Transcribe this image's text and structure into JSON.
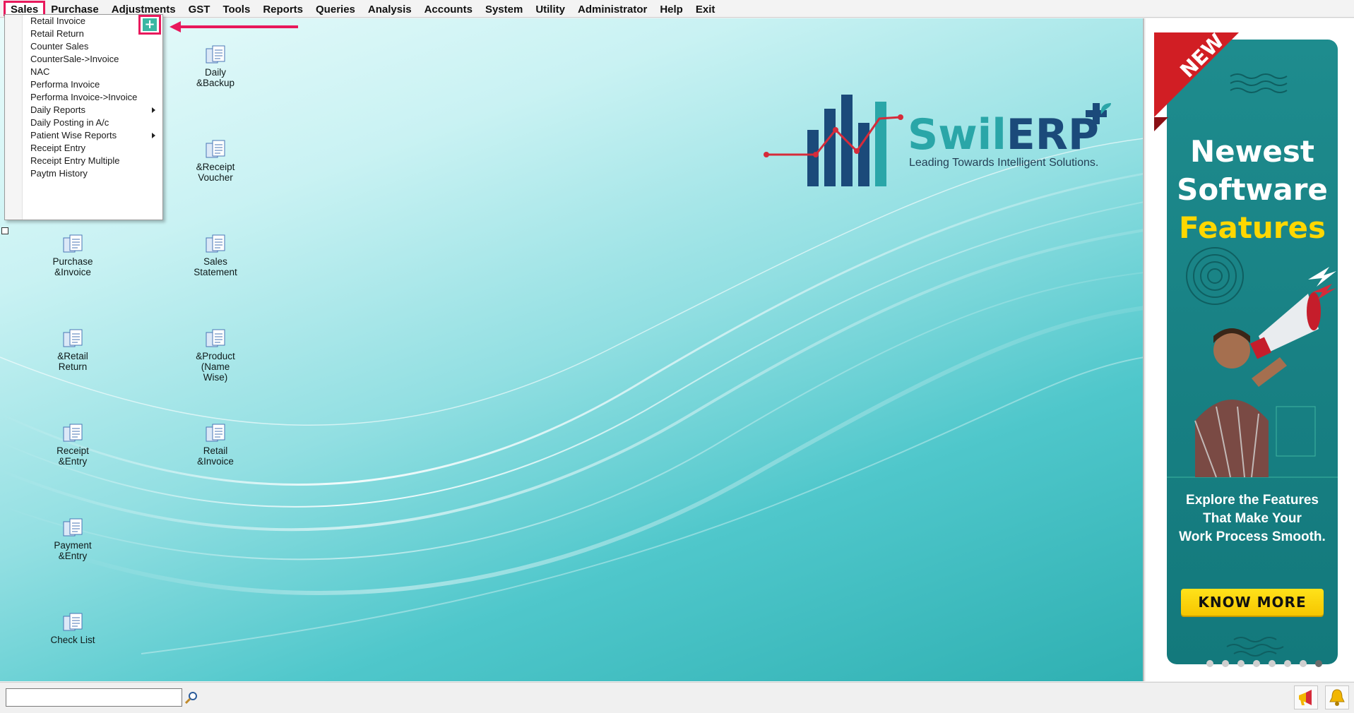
{
  "menubar": {
    "items": [
      "Sales",
      "Purchase",
      "Adjustments",
      "GST",
      "Tools",
      "Reports",
      "Queries",
      "Analysis",
      "Accounts",
      "System",
      "Utility",
      "Administrator",
      "Help",
      "Exit"
    ],
    "active": "Sales"
  },
  "sales_menu": {
    "items": [
      {
        "label": "Retail Invoice",
        "submenu": false
      },
      {
        "label": "Retail Return",
        "submenu": false
      },
      {
        "label": "Counter Sales",
        "submenu": false
      },
      {
        "label": "CounterSale->Invoice",
        "submenu": false
      },
      {
        "label": "NAC",
        "submenu": false
      },
      {
        "label": "Performa Invoice",
        "submenu": false
      },
      {
        "label": "Performa Invoice->Invoice",
        "submenu": false
      },
      {
        "label": "Daily Reports",
        "submenu": true
      },
      {
        "label": "Daily Posting in A/c",
        "submenu": false
      },
      {
        "label": "Patient Wise Reports",
        "submenu": true
      },
      {
        "label": "Receipt Entry",
        "submenu": false
      },
      {
        "label": "Receipt Entry Multiple",
        "submenu": false
      },
      {
        "label": "Paytm History",
        "submenu": false
      }
    ],
    "add_button_icon": "plus-icon",
    "add_button_glyph": "+"
  },
  "desktop_icons": {
    "left": [
      "Purchase\n&Invoice",
      "&Retail\nReturn",
      "Receipt\n&Entry",
      "Payment\n&Entry",
      "Check List"
    ],
    "right": [
      "Daily\n&Backup",
      "&Receipt\nVoucher",
      "Sales\nStatement",
      "&Product\n(Name\nWise)",
      "Retail\n&Invoice"
    ]
  },
  "logo": {
    "name_part1": "Swil",
    "name_part2": "ERP",
    "tagline": "Leading Towards Intelligent Solutions."
  },
  "ad": {
    "ribbon": "NEW",
    "headline1": "Newest",
    "headline2": "Software",
    "headline3": "Features",
    "subtext": "Explore the Features\nThat Make Your\nWork Process Smooth.",
    "button": "KNOW MORE",
    "slides_total": 8,
    "slide_active": 8
  },
  "statusbar": {
    "command_value": "",
    "icons": [
      "search-icon",
      "announcement-icon",
      "notification-bell-icon"
    ]
  },
  "colors": {
    "highlight": "#e8195c",
    "teal": "#2aa6a8",
    "navy": "#1b4a7a",
    "ad_bg": "#177f82",
    "ad_yellow": "#ffd700"
  }
}
